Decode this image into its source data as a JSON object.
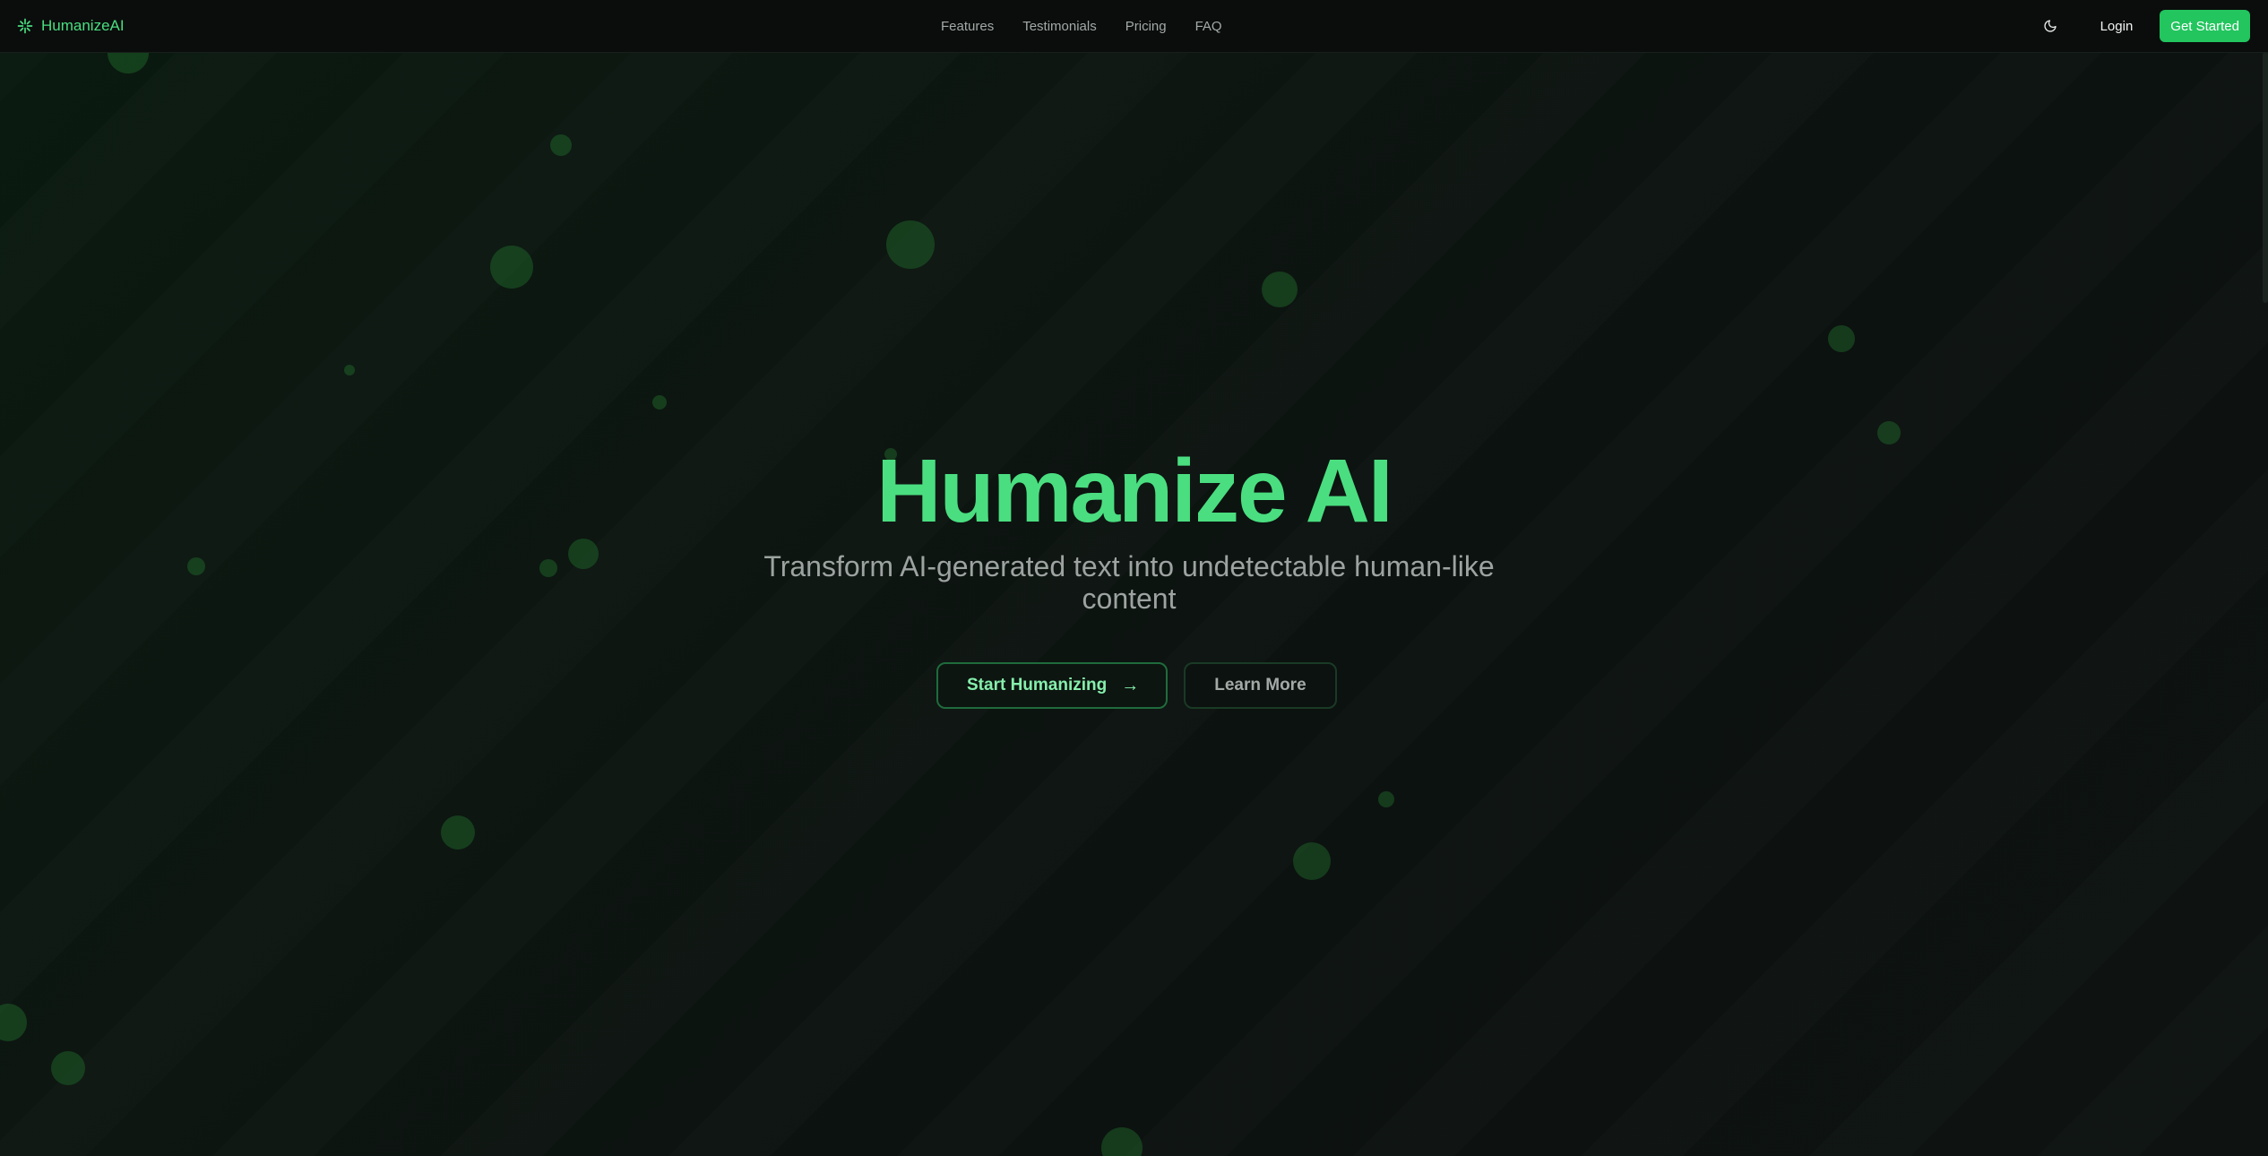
{
  "brand": {
    "name": "HumanizeAI",
    "icon": "sparkle-icon",
    "accent_color": "#4ade80"
  },
  "nav": {
    "links": [
      {
        "label": "Features"
      },
      {
        "label": "Testimonials"
      },
      {
        "label": "Pricing"
      },
      {
        "label": "FAQ"
      }
    ],
    "theme_toggle_icon": "moon-icon",
    "login_label": "Login",
    "cta_label": "Get Started",
    "cta_color": "#22c55e"
  },
  "hero": {
    "title": "Humanize AI",
    "subtitle": "Transform AI-generated text into undetectable human-like content",
    "primary_button": {
      "label": "Start Humanizing",
      "icon": "arrow-right-icon",
      "glyph": "→"
    },
    "secondary_button": {
      "label": "Learn More"
    }
  },
  "colors": {
    "background": "#0c1210",
    "bubble": "#1f5a2c"
  }
}
